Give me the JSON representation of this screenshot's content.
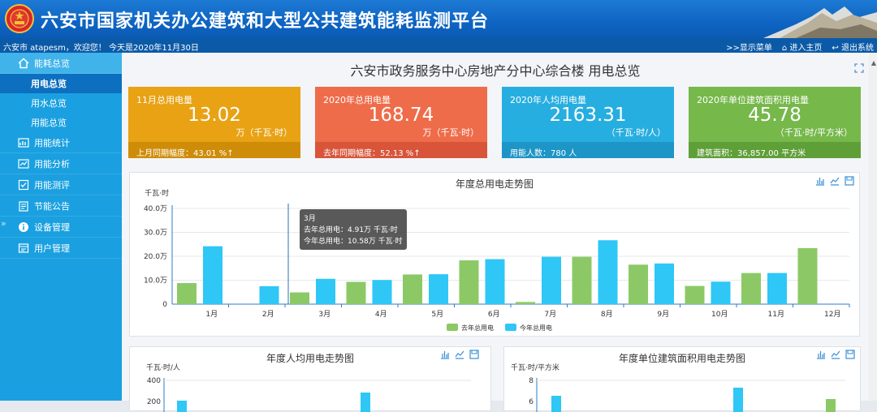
{
  "header": {
    "title": "六安市国家机关办公建筑和大型公共建筑能耗监测平台"
  },
  "subbar": {
    "welcome": "六安市 atapesm，欢迎您！ 今天是2020年11月30日",
    "show_menu": ">>显示菜单",
    "home": "进入主页",
    "logout": "退出系统"
  },
  "sidebar": {
    "section": {
      "label": "能耗总览",
      "icon": "home-icon"
    },
    "subitems": [
      {
        "label": "用电总览",
        "active": true
      },
      {
        "label": "用水总览",
        "active": false
      },
      {
        "label": "用能总览",
        "active": false
      }
    ],
    "items": [
      {
        "label": "用能统计",
        "icon": "stats-icon"
      },
      {
        "label": "用能分析",
        "icon": "analysis-icon"
      },
      {
        "label": "用能测评",
        "icon": "evaluate-icon"
      },
      {
        "label": "节能公告",
        "icon": "notice-icon"
      },
      {
        "label": "设备管理",
        "icon": "info-icon"
      },
      {
        "label": "用户管理",
        "icon": "user-admin-icon"
      }
    ],
    "toggle": "»"
  },
  "main": {
    "title": "六安市政务服务中心房地产分中心综合楼 用电总览"
  },
  "cards": [
    {
      "label": "11月总用电量",
      "value": "13.02",
      "unit": "万（千瓦·时）",
      "footer": "上月同期幅度：43.01 %",
      "arrow": "↑",
      "color": "#e8a214",
      "foot_color": "#cf8c08"
    },
    {
      "label": "2020年总用电量",
      "value": "168.74",
      "unit": "万（千瓦·时）",
      "footer": "去年同期幅度：52.13 %",
      "arrow": "↑",
      "color": "#ef6c4a",
      "foot_color": "#d8553a"
    },
    {
      "label": "2020年人均用电量",
      "value": "2163.31",
      "unit": "（千瓦·时/人）",
      "footer": "用能人数：780 人",
      "arrow": "",
      "color": "#27aee0",
      "foot_color": "#1d95c6"
    },
    {
      "label": "2020年单位建筑面积用电量",
      "value": "45.78",
      "unit": "（千瓦·时/平方米）",
      "footer": "建筑面积：36,857.00 平方米",
      "arrow": "",
      "color": "#76b84a",
      "foot_color": "#5f9f38"
    }
  ],
  "chart_data": [
    {
      "type": "bar",
      "title": "年度总用电走势图",
      "ylabel": "千瓦·时",
      "ytick_labels": [
        "0",
        "10.0万",
        "20.0万",
        "30.0万",
        "40.0万"
      ],
      "ylim": [
        0,
        40
      ],
      "categories": [
        "1月",
        "2月",
        "3月",
        "4月",
        "5月",
        "6月",
        "7月",
        "8月",
        "9月",
        "10月",
        "11月",
        "12月"
      ],
      "series": [
        {
          "name": "去年总用电",
          "color": "#8cc966",
          "values": [
            8.8,
            0,
            4.91,
            9.3,
            12.4,
            18.3,
            0.9,
            19.8,
            16.5,
            7.6,
            13.0,
            23.4
          ]
        },
        {
          "name": "今年总用电",
          "color": "#2ec7f6",
          "values": [
            24.2,
            7.5,
            10.58,
            10.1,
            12.5,
            18.8,
            19.8,
            26.7,
            17.0,
            9.4,
            13.02,
            null
          ]
        }
      ],
      "legend": "bottom",
      "tooltip": {
        "title": "3月",
        "line1": "去年总用电：4.91万 千瓦·时",
        "line2": "今年总用电：10.58万 千瓦·时"
      }
    },
    {
      "type": "bar",
      "title": "年度人均用电走势图",
      "ylabel": "千瓦·时/人",
      "ytick_labels": [
        "200",
        "400"
      ],
      "ylim": [
        0,
        400
      ]
    },
    {
      "type": "bar",
      "title": "年度单位建筑面积用电走势图",
      "ylabel": "千瓦·时/平方米",
      "ytick_labels": [
        "6",
        "8"
      ],
      "ylim": [
        0,
        8
      ]
    }
  ]
}
